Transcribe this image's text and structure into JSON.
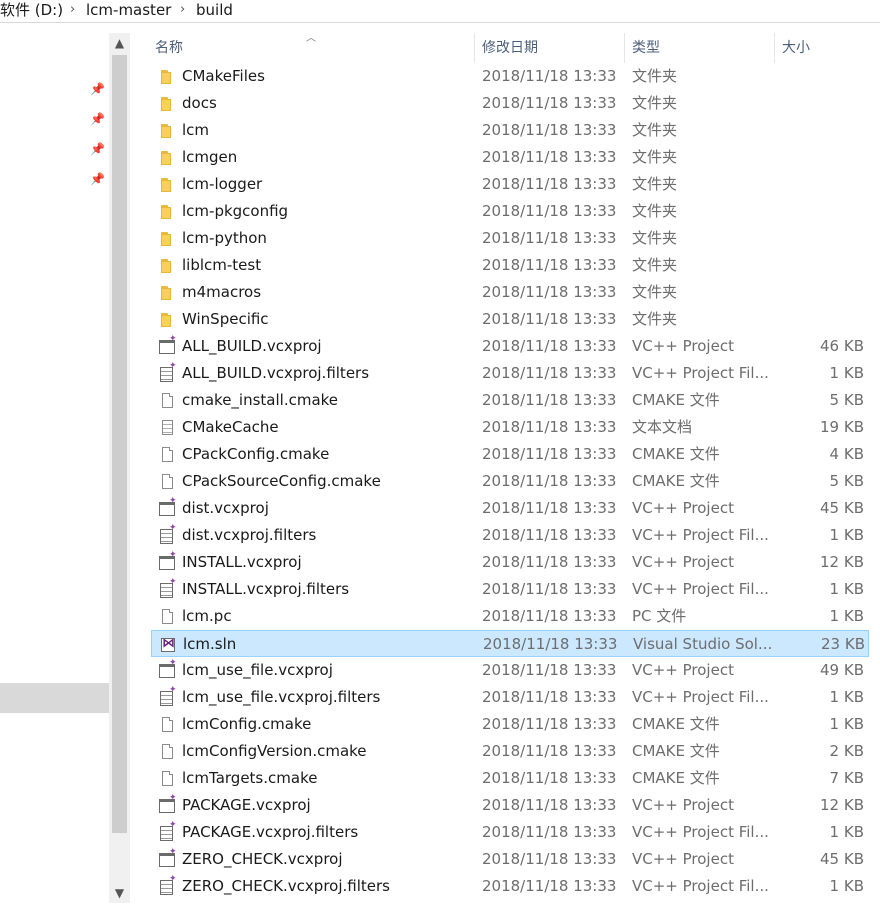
{
  "address": {
    "crumbs": [
      "软件 (D:)",
      "lcm-master",
      "build"
    ]
  },
  "columns": {
    "name": "名称",
    "date": "修改日期",
    "type": "类型",
    "size": "大小"
  },
  "rows": [
    {
      "name": "CMakeFiles",
      "date": "2018/11/18 13:33",
      "type": "文件夹",
      "size": "",
      "icon": "folder-icon"
    },
    {
      "name": "docs",
      "date": "2018/11/18 13:33",
      "type": "文件夹",
      "size": "",
      "icon": "folder-icon"
    },
    {
      "name": "lcm",
      "date": "2018/11/18 13:33",
      "type": "文件夹",
      "size": "",
      "icon": "folder-icon"
    },
    {
      "name": "lcmgen",
      "date": "2018/11/18 13:33",
      "type": "文件夹",
      "size": "",
      "icon": "folder-icon"
    },
    {
      "name": "lcm-logger",
      "date": "2018/11/18 13:33",
      "type": "文件夹",
      "size": "",
      "icon": "folder-icon"
    },
    {
      "name": "lcm-pkgconfig",
      "date": "2018/11/18 13:33",
      "type": "文件夹",
      "size": "",
      "icon": "folder-icon"
    },
    {
      "name": "lcm-python",
      "date": "2018/11/18 13:33",
      "type": "文件夹",
      "size": "",
      "icon": "folder-icon"
    },
    {
      "name": "liblcm-test",
      "date": "2018/11/18 13:33",
      "type": "文件夹",
      "size": "",
      "icon": "folder-icon"
    },
    {
      "name": "m4macros",
      "date": "2018/11/18 13:33",
      "type": "文件夹",
      "size": "",
      "icon": "folder-icon"
    },
    {
      "name": "WinSpecific",
      "date": "2018/11/18 13:33",
      "type": "文件夹",
      "size": "",
      "icon": "folder-icon"
    },
    {
      "name": "ALL_BUILD.vcxproj",
      "date": "2018/11/18 13:33",
      "type": "VC++ Project",
      "size": "46 KB",
      "icon": "vcxproj-icon"
    },
    {
      "name": "ALL_BUILD.vcxproj.filters",
      "date": "2018/11/18 13:33",
      "type": "VC++ Project Fil...",
      "size": "1 KB",
      "icon": "filters-icon"
    },
    {
      "name": "cmake_install.cmake",
      "date": "2018/11/18 13:33",
      "type": "CMAKE 文件",
      "size": "5 KB",
      "icon": "file-icon"
    },
    {
      "name": "CMakeCache",
      "date": "2018/11/18 13:33",
      "type": "文本文档",
      "size": "19 KB",
      "icon": "text-file-icon"
    },
    {
      "name": "CPackConfig.cmake",
      "date": "2018/11/18 13:33",
      "type": "CMAKE 文件",
      "size": "4 KB",
      "icon": "file-icon"
    },
    {
      "name": "CPackSourceConfig.cmake",
      "date": "2018/11/18 13:33",
      "type": "CMAKE 文件",
      "size": "5 KB",
      "icon": "file-icon"
    },
    {
      "name": "dist.vcxproj",
      "date": "2018/11/18 13:33",
      "type": "VC++ Project",
      "size": "45 KB",
      "icon": "vcxproj-icon"
    },
    {
      "name": "dist.vcxproj.filters",
      "date": "2018/11/18 13:33",
      "type": "VC++ Project Fil...",
      "size": "1 KB",
      "icon": "filters-icon"
    },
    {
      "name": "INSTALL.vcxproj",
      "date": "2018/11/18 13:33",
      "type": "VC++ Project",
      "size": "12 KB",
      "icon": "vcxproj-icon"
    },
    {
      "name": "INSTALL.vcxproj.filters",
      "date": "2018/11/18 13:33",
      "type": "VC++ Project Fil...",
      "size": "1 KB",
      "icon": "filters-icon"
    },
    {
      "name": "lcm.pc",
      "date": "2018/11/18 13:33",
      "type": "PC 文件",
      "size": "1 KB",
      "icon": "file-icon"
    },
    {
      "name": "lcm.sln",
      "date": "2018/11/18 13:33",
      "type": "Visual Studio Sol...",
      "size": "23 KB",
      "icon": "sln-icon",
      "selected": true
    },
    {
      "name": "lcm_use_file.vcxproj",
      "date": "2018/11/18 13:33",
      "type": "VC++ Project",
      "size": "49 KB",
      "icon": "vcxproj-icon"
    },
    {
      "name": "lcm_use_file.vcxproj.filters",
      "date": "2018/11/18 13:33",
      "type": "VC++ Project Fil...",
      "size": "1 KB",
      "icon": "filters-icon"
    },
    {
      "name": "lcmConfig.cmake",
      "date": "2018/11/18 13:33",
      "type": "CMAKE 文件",
      "size": "1 KB",
      "icon": "file-icon"
    },
    {
      "name": "lcmConfigVersion.cmake",
      "date": "2018/11/18 13:33",
      "type": "CMAKE 文件",
      "size": "2 KB",
      "icon": "file-icon"
    },
    {
      "name": "lcmTargets.cmake",
      "date": "2018/11/18 13:33",
      "type": "CMAKE 文件",
      "size": "7 KB",
      "icon": "file-icon"
    },
    {
      "name": "PACKAGE.vcxproj",
      "date": "2018/11/18 13:33",
      "type": "VC++ Project",
      "size": "12 KB",
      "icon": "vcxproj-icon"
    },
    {
      "name": "PACKAGE.vcxproj.filters",
      "date": "2018/11/18 13:33",
      "type": "VC++ Project Fil...",
      "size": "1 KB",
      "icon": "filters-icon"
    },
    {
      "name": "ZERO_CHECK.vcxproj",
      "date": "2018/11/18 13:33",
      "type": "VC++ Project",
      "size": "45 KB",
      "icon": "vcxproj-icon"
    },
    {
      "name": "ZERO_CHECK.vcxproj.filters",
      "date": "2018/11/18 13:33",
      "type": "VC++ Project Fil...",
      "size": "1 KB",
      "icon": "filters-icon"
    }
  ],
  "colors": {
    "selection_bg": "#cce8ff",
    "selection_border": "#99d1ff",
    "header_text": "#4c607a"
  }
}
